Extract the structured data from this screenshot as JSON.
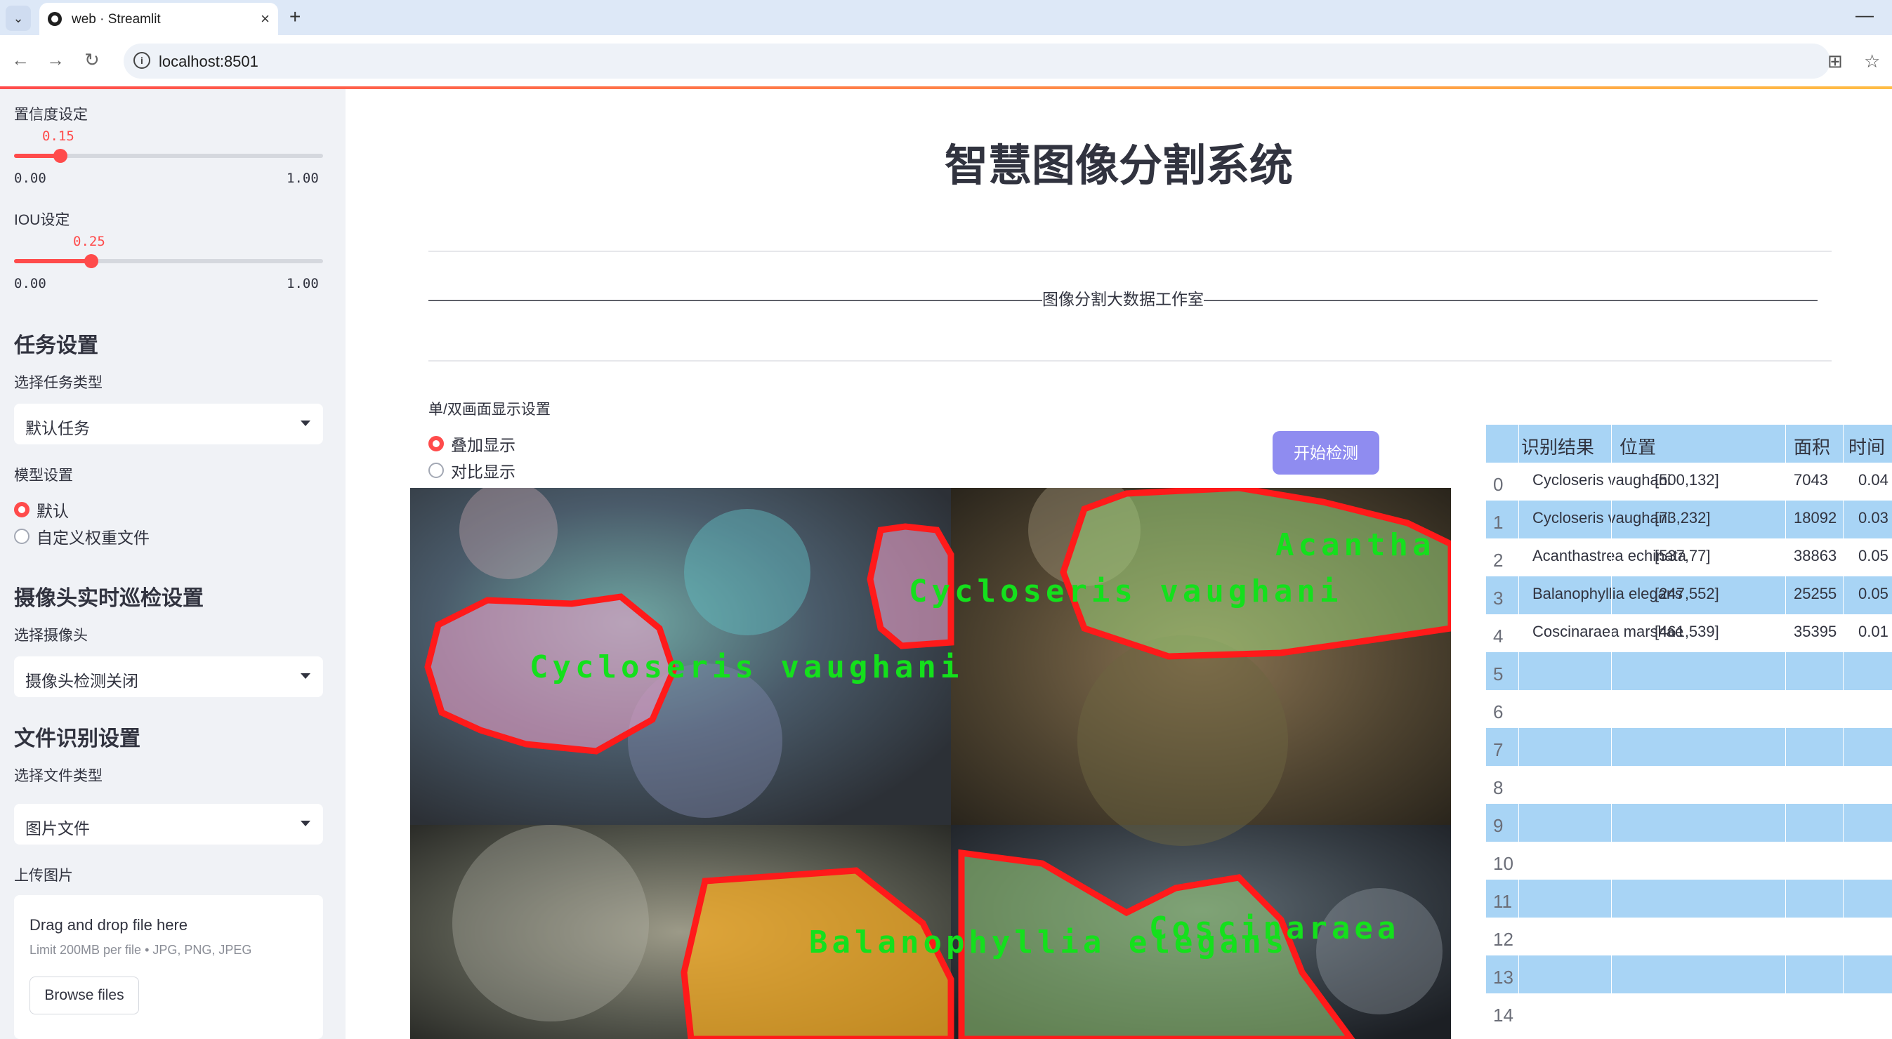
{
  "browser": {
    "tab_title": "web · Streamlit",
    "url": "localhost:8501"
  },
  "sidebar": {
    "confidence": {
      "label": "置信度设定",
      "value": "0.15",
      "min": "0.00",
      "max": "1.00",
      "fraction": 0.15
    },
    "iou": {
      "label": "IOU设定",
      "value": "0.25",
      "min": "0.00",
      "max": "1.00",
      "fraction": 0.25
    },
    "task_section": {
      "heading": "任务设置",
      "select_label": "选择任务类型",
      "selected": "默认任务"
    },
    "model_section": {
      "label": "模型设置",
      "options": [
        "默认",
        "自定义权重文件"
      ],
      "selected_index": 0
    },
    "camera_section": {
      "heading": "摄像头实时巡检设置",
      "select_label": "选择摄像头",
      "selected": "摄像头检测关闭"
    },
    "file_section": {
      "heading": "文件识别设置",
      "select_label": "选择文件类型",
      "selected": "图片文件"
    },
    "upload": {
      "label": "上传图片",
      "title": "Drag and drop file here",
      "limit": "Limit 200MB per file • JPG, PNG, JPEG",
      "button": "Browse files"
    }
  },
  "main": {
    "title": "智慧图像分割系统",
    "studio": "——————————————————————————————————————图像分割大数据工作室——————————————————————————————————————",
    "display_label": "单/双画面显示设置",
    "display_options": [
      "叠加显示",
      "对比显示"
    ],
    "display_selected_index": 0,
    "start_button": "开始检测",
    "detections_overlay": [
      "Cycloseris vaughani",
      "Cycloseris vaughani",
      "Acantha",
      "Balanophyllia elegans",
      "Coscinaraea"
    ]
  },
  "table": {
    "headers": [
      "识别结果",
      "位置",
      "面积",
      "时间"
    ],
    "rows": [
      {
        "idx": "0",
        "result": "Cycloseris vaughani",
        "pos": "[500,132]",
        "area": "7043",
        "time": "0.04"
      },
      {
        "idx": "1",
        "result": "Cycloseris vaughani",
        "pos": "[73,232]",
        "area": "18092",
        "time": "0.03"
      },
      {
        "idx": "2",
        "result": "Acanthastrea echinata",
        "pos": "[537,77]",
        "area": "38863",
        "time": "0.05"
      },
      {
        "idx": "3",
        "result": "Balanophyllia elegans",
        "pos": "[247,552]",
        "area": "25255",
        "time": "0.05"
      },
      {
        "idx": "4",
        "result": "Coscinaraea marshae",
        "pos": "[461,539]",
        "area": "35395",
        "time": "0.01"
      }
    ],
    "empty_rows": [
      "5",
      "6",
      "7",
      "8",
      "9",
      "10",
      "11",
      "12",
      "13",
      "14"
    ]
  },
  "colors": {
    "accent": "#ff4b4b",
    "button": "#8f8cf0",
    "table_stripe": "#a8d4f5",
    "mask_outline": "#ff1a1a",
    "label_text": "#14e01c"
  }
}
